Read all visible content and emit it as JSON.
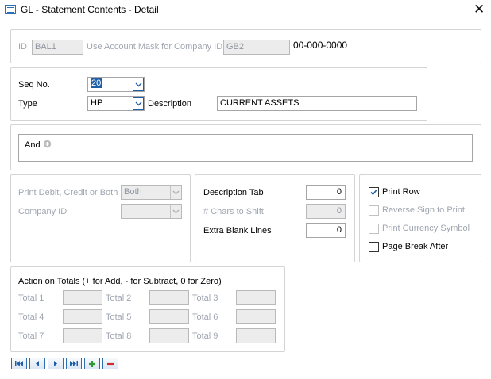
{
  "window": {
    "title": "GL - Statement Contents - Detail",
    "icon": "form-icon",
    "close_icon": "close-icon"
  },
  "header": {
    "id_label": "ID",
    "id_value": "BAL1",
    "mask_label": "Use Account Mask for Company ID",
    "mask_value": "GB2",
    "mask_format": "00-000-0000"
  },
  "seq": {
    "seq_label": "Seq No.",
    "seq_value": "20",
    "type_label": "Type",
    "type_value": "HP",
    "desc_label": "Description",
    "desc_value": "CURRENT ASSETS"
  },
  "and_panel": {
    "and_label": "And",
    "add_icon": "plus-circle-icon"
  },
  "print_opts": {
    "pdcb_label": "Print Debit, Credit or Both",
    "pdcb_value": "Both",
    "company_label": "Company ID",
    "company_value": ""
  },
  "desc_opts": {
    "tab_label": "Description Tab",
    "tab_value": "0",
    "chars_label": "# Chars to Shift",
    "chars_value": "0",
    "blank_label": "Extra Blank Lines",
    "blank_value": "0"
  },
  "checks": {
    "print_row": {
      "label": "Print Row",
      "checked": true
    },
    "reverse_sign": {
      "label": "Reverse Sign to Print",
      "checked": false
    },
    "print_currency": {
      "label": "Print Currency Symbol",
      "checked": false
    },
    "page_break": {
      "label": "Page Break After",
      "checked": false
    }
  },
  "totals": {
    "heading": "Action on Totals (+ for Add, - for Subtract, 0 for Zero)",
    "labels": [
      "Total 1",
      "Total 2",
      "Total 3",
      "Total 4",
      "Total 5",
      "Total 6",
      "Total 7",
      "Total 8",
      "Total 9"
    ],
    "values": [
      "",
      "",
      "",
      "",
      "",
      "",
      "",
      "",
      ""
    ]
  },
  "navigator": [
    "first-record-icon",
    "previous-record-icon",
    "next-record-icon",
    "last-record-icon",
    "add-record-icon",
    "delete-record-icon"
  ],
  "colors": {
    "accent": "#1e5fa8",
    "add_green": "#2e9a2e",
    "delete_red": "#d22b2b",
    "disabled_text": "#a0a6b0"
  }
}
